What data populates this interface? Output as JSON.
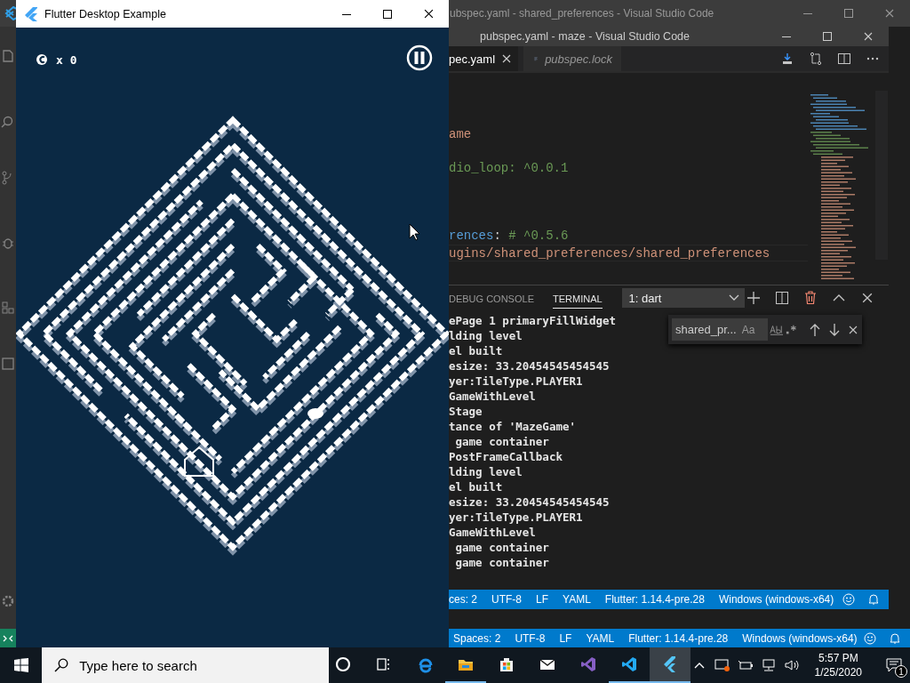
{
  "back_window": {
    "title": "ubspec.yaml - shared_preferences - Visual Studio Code",
    "status_bar": [
      "Spaces: 2",
      "UTF-8",
      "LF",
      "YAML",
      "Flutter: 1.14.4-pre.28",
      "Windows (windows-x64)"
    ]
  },
  "flutter_window": {
    "title": "Flutter Desktop Example",
    "coins": "x 0"
  },
  "editor_window": {
    "title": "pubspec.yaml - maze - Visual Studio Code",
    "tabs": [
      {
        "label": "pec.yaml",
        "selected": true
      },
      {
        "label": "pubspec.lock",
        "selected": false
      }
    ],
    "code_lines": [
      {
        "current": false,
        "tokens": [
          {
            "text": "ame",
            "kind": "string"
          }
        ]
      },
      {
        "current": false,
        "tokens": [
          {
            "text": "dio_loop: ^0.0.1",
            "kind": "comment"
          }
        ]
      },
      {
        "current": false,
        "tokens": [
          {
            "text": "rences",
            "kind": "key"
          },
          {
            "text": ": ",
            "kind": "punct"
          },
          {
            "text": "# ^0.5.6",
            "kind": "comment"
          }
        ]
      },
      {
        "current": true,
        "tokens": [
          {
            "text": "ugins/shared_preferences/shared_preferences",
            "kind": "string"
          }
        ]
      }
    ],
    "panel": {
      "tabs": [
        {
          "label": "DEBUG CONSOLE",
          "selected": false
        },
        {
          "label": "TERMINAL",
          "selected": true
        }
      ],
      "terminal_select": "1: dart",
      "find": {
        "value": "shared_pr...",
        "match_case": "Aa"
      },
      "terminal_lines": [
        "ePage 1 primaryFillWidget",
        "lding level",
        "el built",
        "esize: 33.20454545454545",
        "yer:TileType.PLAYER1",
        "GameWithLevel",
        "Stage",
        "tance of 'MazeGame'",
        " game container",
        "PostFrameCallback",
        "lding level",
        "el built",
        "esize: 33.20454545454545",
        "yer:TileType.PLAYER1",
        "GameWithLevel",
        " game container",
        " game container"
      ]
    },
    "status_bar": [
      "ces: 2",
      "UTF-8",
      "LF",
      "YAML",
      "Flutter: 1.14.4-pre.28",
      "Windows (windows-x64)"
    ]
  },
  "taskbar": {
    "search_placeholder": "Type here to search",
    "apps": [
      {
        "kind": "cortana",
        "running": false,
        "selected": false
      },
      {
        "kind": "taskview",
        "running": false,
        "selected": false
      },
      {
        "kind": "edge",
        "running": false,
        "selected": false
      },
      {
        "kind": "explorer",
        "running": true,
        "selected": false
      },
      {
        "kind": "store",
        "running": false,
        "selected": false
      },
      {
        "kind": "mail",
        "running": false,
        "selected": false
      },
      {
        "kind": "vs",
        "running": false,
        "selected": false
      },
      {
        "kind": "vscode",
        "running": true,
        "selected": false
      },
      {
        "kind": "flutter",
        "running": true,
        "selected": true
      }
    ],
    "time": "5:57 PM",
    "date": "1/25/2020",
    "notifications": "1"
  }
}
